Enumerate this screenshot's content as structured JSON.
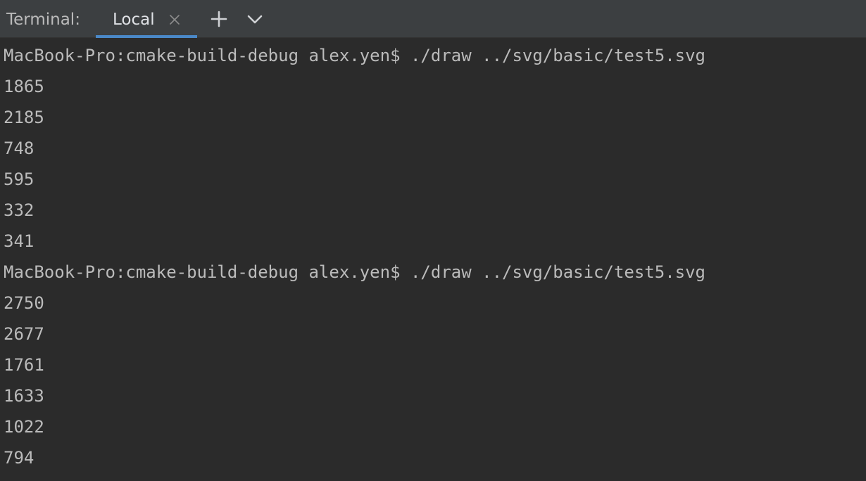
{
  "tabbar": {
    "title": "Terminal:",
    "tabs": [
      {
        "label": "Local",
        "active": true
      }
    ],
    "add_icon": "plus-icon",
    "close_icon": "close-icon",
    "dropdown_icon": "chevron-down-icon"
  },
  "terminal": {
    "lines": [
      "MacBook-Pro:cmake-build-debug alex.yen$ ./draw ../svg/basic/test5.svg",
      "1865",
      "2185",
      "748",
      "595",
      "332",
      "341",
      "MacBook-Pro:cmake-build-debug alex.yen$ ./draw ../svg/basic/test5.svg",
      "2750",
      "2677",
      "1761",
      "1633",
      "1022",
      "794"
    ]
  },
  "colors": {
    "background": "#2b2b2b",
    "tabbar": "#3c3f41",
    "text": "#bbbbbb",
    "accent": "#4a88c7"
  }
}
